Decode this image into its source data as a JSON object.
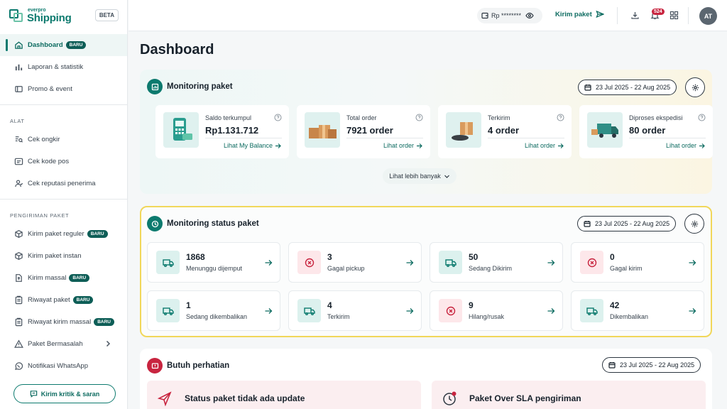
{
  "brand": {
    "small": "everpro",
    "name": "Shipping",
    "beta": "BETA"
  },
  "sidebar": {
    "items": [
      {
        "label": "Dashboard",
        "badge": "BARU",
        "icon": "home-icon",
        "active": true
      },
      {
        "label": "Laporan & statistik",
        "icon": "bar-chart-icon"
      },
      {
        "label": "Promo & event",
        "icon": "ticket-icon"
      }
    ],
    "sections": [
      {
        "title": "ALAT",
        "items": [
          {
            "label": "Cek ongkir",
            "icon": "list-search-icon"
          },
          {
            "label": "Cek kode pos",
            "icon": "postcode-icon"
          },
          {
            "label": "Cek reputasi penerima",
            "icon": "user-check-icon"
          }
        ]
      },
      {
        "title": "PENGIRIMAN PAKET",
        "items": [
          {
            "label": "Kirim paket reguler",
            "badge": "BARU",
            "icon": "box-icon"
          },
          {
            "label": "Kirim paket instan",
            "icon": "box-icon"
          },
          {
            "label": "Kirim massal",
            "badge": "BARU",
            "icon": "file-upload-icon"
          },
          {
            "label": "Riwayat paket",
            "badge": "BARU",
            "icon": "clipboard-icon"
          },
          {
            "label": "Riwayat kirim massal",
            "badge": "BARU",
            "icon": "clipboard-icon"
          },
          {
            "label": "Paket Bermasalah",
            "icon": "warning-icon",
            "chevron": true
          },
          {
            "label": "Notifikasi WhatsApp",
            "icon": "whatsapp-icon"
          }
        ]
      }
    ],
    "feedback_label": "Kirim kritik & saran"
  },
  "topbar": {
    "saldo_label": "Rp ********",
    "kirim_label": "Kirim paket",
    "notif_count": "524",
    "avatar_initials": "AT"
  },
  "page_title": "Dashboard",
  "monitoring_paket": {
    "title": "Monitoring paket",
    "date_range": "23 Jul 2025 - 22 Aug 2025",
    "cards": [
      {
        "label": "Saldo terkumpul",
        "value": "Rp1.131.712",
        "link": "Lihat My Balance"
      },
      {
        "label": "Total order",
        "value": "7921 order",
        "link": "Lihat order"
      },
      {
        "label": "Terkirim",
        "value": "4 order",
        "link": "Lihat order"
      },
      {
        "label": "Diproses ekspedisi",
        "value": "80 order",
        "link": "Lihat order"
      }
    ],
    "more_label": "Lihat lebih banyak"
  },
  "monitoring_status": {
    "title": "Monitoring status paket",
    "date_range": "23 Jul 2025 - 22 Aug 2025",
    "cards": [
      {
        "value": "1868",
        "label": "Menunggu dijemput",
        "tone": "green",
        "icon": "truck-icon"
      },
      {
        "value": "3",
        "label": "Gagal pickup",
        "tone": "red",
        "icon": "x-circle-icon"
      },
      {
        "value": "50",
        "label": "Sedang Dikirim",
        "tone": "green",
        "icon": "truck-icon"
      },
      {
        "value": "0",
        "label": "Gagal kirim",
        "tone": "red",
        "icon": "x-circle-icon"
      },
      {
        "value": "1",
        "label": "Sedang dikembalikan",
        "tone": "green",
        "icon": "truck-icon"
      },
      {
        "value": "4",
        "label": "Terkirim",
        "tone": "green",
        "icon": "truck-icon"
      },
      {
        "value": "9",
        "label": "Hilang/rusak",
        "tone": "red",
        "icon": "x-circle-icon"
      },
      {
        "value": "42",
        "label": "Dikembalikan",
        "tone": "green",
        "icon": "truck-icon"
      }
    ]
  },
  "butuh_perhatian": {
    "title": "Butuh perhatian",
    "date_range": "23 Jul 2025 - 22 Aug 2025",
    "cards": [
      {
        "title": "Status paket tidak ada update",
        "icon": "send-alert-icon"
      },
      {
        "title": "Paket Over SLA pengiriman",
        "icon": "clock-alert-icon"
      }
    ]
  },
  "colors": {
    "primary": "#0c7a6e",
    "danger": "#c8243f",
    "highlight_border": "#f1d75a"
  }
}
